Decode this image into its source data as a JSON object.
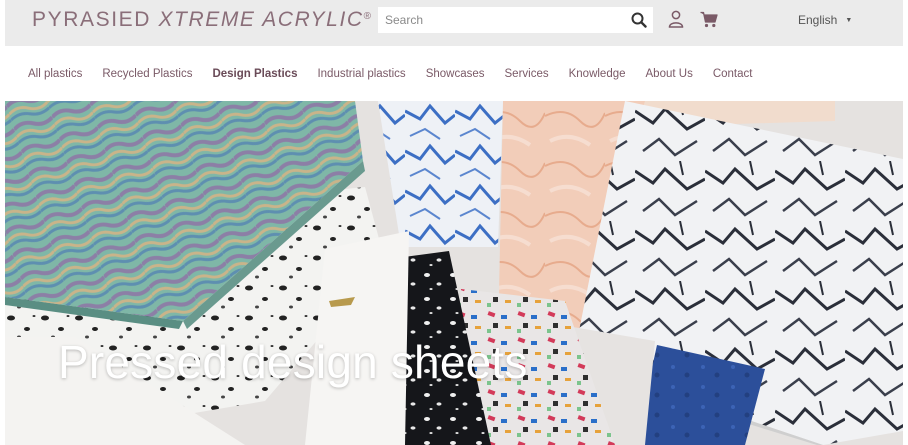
{
  "brand": {
    "name_part1": "PYRASIED",
    "name_part2": "XTREME ACRYLIC",
    "registered": "®",
    "color": "#8a6e79"
  },
  "search": {
    "placeholder": "Search",
    "icon": "search-icon"
  },
  "header_icons": {
    "user": "user-icon",
    "cart": "cart-icon"
  },
  "language": {
    "selected": "English",
    "icon": "caret-down-icon"
  },
  "nav": {
    "items": [
      {
        "label": "All plastics"
      },
      {
        "label": "Recycled Plastics"
      },
      {
        "label": "Design Plastics"
      },
      {
        "label": "Industrial plastics"
      },
      {
        "label": "Showcases"
      },
      {
        "label": "Services"
      },
      {
        "label": "Knowledge"
      },
      {
        "label": "About Us"
      },
      {
        "label": "Contact"
      }
    ],
    "active_index": 2,
    "color": "#7a5a67"
  },
  "hero": {
    "title": "Pressed design sheets"
  }
}
